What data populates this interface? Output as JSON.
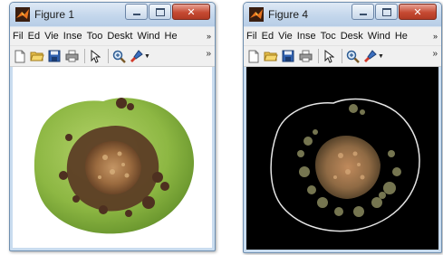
{
  "windows": [
    {
      "title": "Figure 1",
      "menu": [
        "Fil",
        "Ed",
        "Vie",
        "Inse",
        "Too",
        "Deskt",
        "Wind",
        "He"
      ],
      "menu_more": "»",
      "toolbar_more": "»",
      "axes_background": "#ffffff",
      "display": "original-leaf-image"
    },
    {
      "title": "Figure 4",
      "menu": [
        "Fil",
        "Ed",
        "Vie",
        "Inse",
        "Toc",
        "Desk",
        "Wind",
        "He"
      ],
      "menu_more": "»",
      "toolbar_more": "»",
      "axes_background": "#000000",
      "display": "segmented-lesion-image"
    }
  ],
  "toolbar_icons": [
    "new-file-icon",
    "open-folder-icon",
    "save-icon",
    "print-icon",
    "pointer-icon",
    "zoom-in-icon",
    "data-brush-icon"
  ],
  "colors": {
    "titlebar": "#c4d7ec",
    "close_button": "#c64a32",
    "menubar": "#f0f0f0"
  }
}
